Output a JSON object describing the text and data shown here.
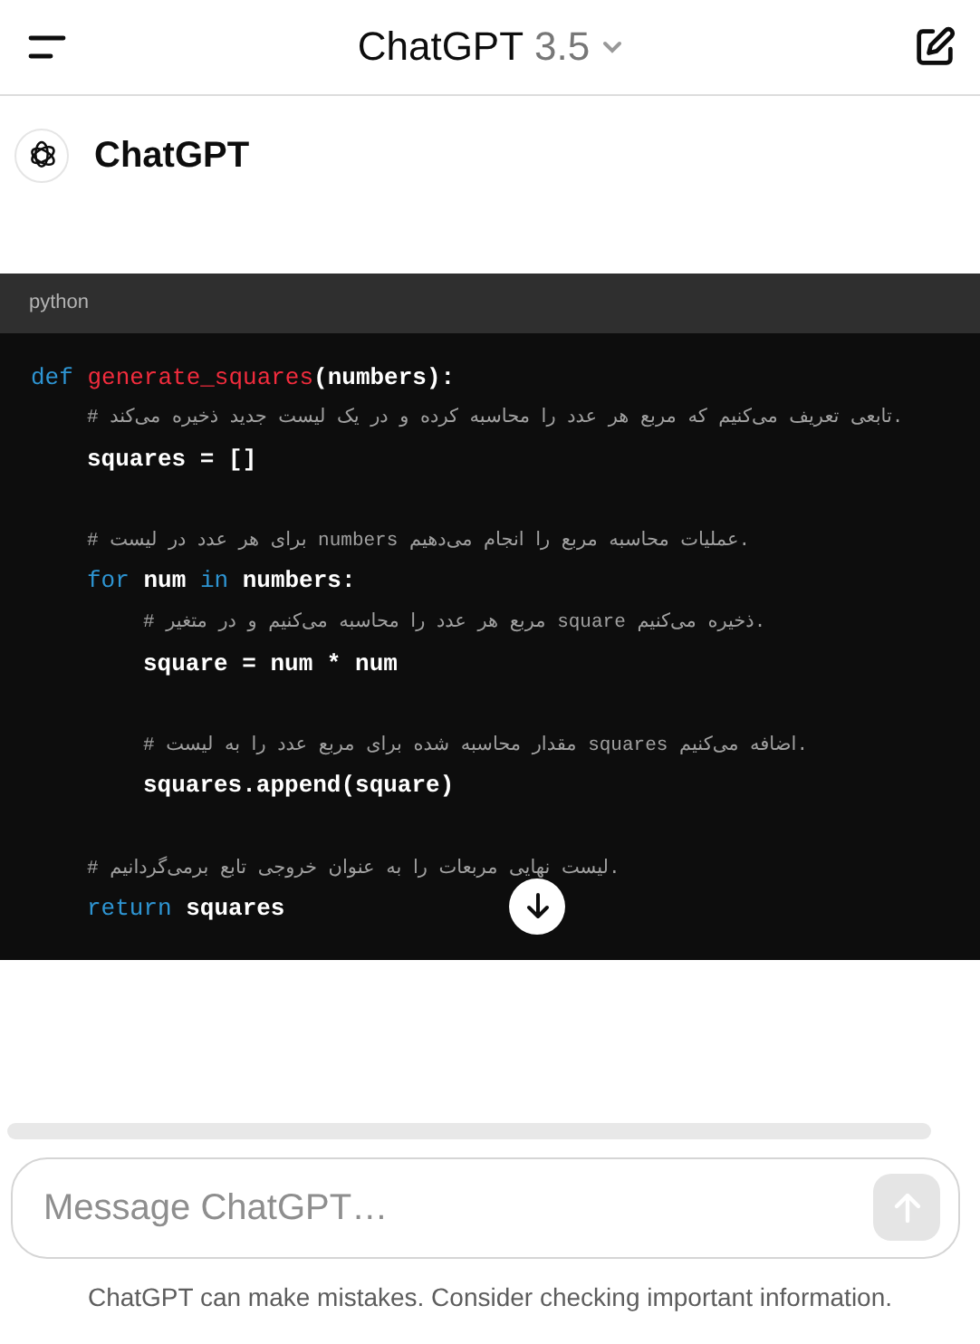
{
  "header": {
    "title": "ChatGPT",
    "version": "3.5"
  },
  "message": {
    "author": "ChatGPT",
    "code_block": {
      "language": "python",
      "lines": [
        {
          "tokens": [
            {
              "kind": "keyword",
              "text": "def "
            },
            {
              "kind": "function",
              "text": "generate_squares"
            },
            {
              "kind": "plain",
              "text": "(numbers):"
            }
          ],
          "children": [
            {
              "tokens": [
                {
                  "kind": "comment",
                  "text": "# تابعی تعریف می‌کنیم که مربع هر عدد را محاسبه کرده و در یک لیست جدید ذخیره می‌کند."
                }
              ]
            },
            {
              "tokens": [
                {
                  "kind": "plain",
                  "text": "squares = []"
                }
              ]
            },
            {
              "kind": "blank"
            },
            {
              "tokens": [
                {
                  "kind": "comment",
                  "text": "# برای هر عدد در لیست numbers عملیات محاسبه مربع را انجام می‌دهیم."
                }
              ]
            },
            {
              "tokens": [
                {
                  "kind": "keyword",
                  "text": "for "
                },
                {
                  "kind": "plain",
                  "text": "num "
                },
                {
                  "kind": "keyword",
                  "text": "in "
                },
                {
                  "kind": "plain",
                  "text": "numbers:"
                }
              ],
              "children": [
                {
                  "tokens": [
                    {
                      "kind": "comment",
                      "text": "# مربع هر عدد را محاسبه می‌کنیم و در متغیر square ذخیره می‌کنیم."
                    }
                  ]
                },
                {
                  "tokens": [
                    {
                      "kind": "plain",
                      "text": "square = num * num"
                    }
                  ]
                },
                {
                  "kind": "blank"
                },
                {
                  "tokens": [
                    {
                      "kind": "comment",
                      "text": "# مقدار محاسبه شده برای مربع عدد را به لیست squares اضافه می‌کنیم."
                    }
                  ]
                },
                {
                  "tokens": [
                    {
                      "kind": "plain",
                      "text": "squares.append(square)"
                    }
                  ]
                }
              ]
            },
            {
              "kind": "blank"
            },
            {
              "tokens": [
                {
                  "kind": "comment",
                  "text": "# لیست نهایی مربعات را به عنوان خروجی تابع برمی‌گردانیم."
                }
              ]
            },
            {
              "tokens": [
                {
                  "kind": "keyword",
                  "text": "return "
                },
                {
                  "kind": "plain",
                  "text": "squares"
                }
              ]
            }
          ]
        }
      ]
    }
  },
  "composer": {
    "placeholder": "Message ChatGPT…",
    "send_disabled": true
  },
  "disclaimer": "ChatGPT can make mistakes. Consider checking important information."
}
